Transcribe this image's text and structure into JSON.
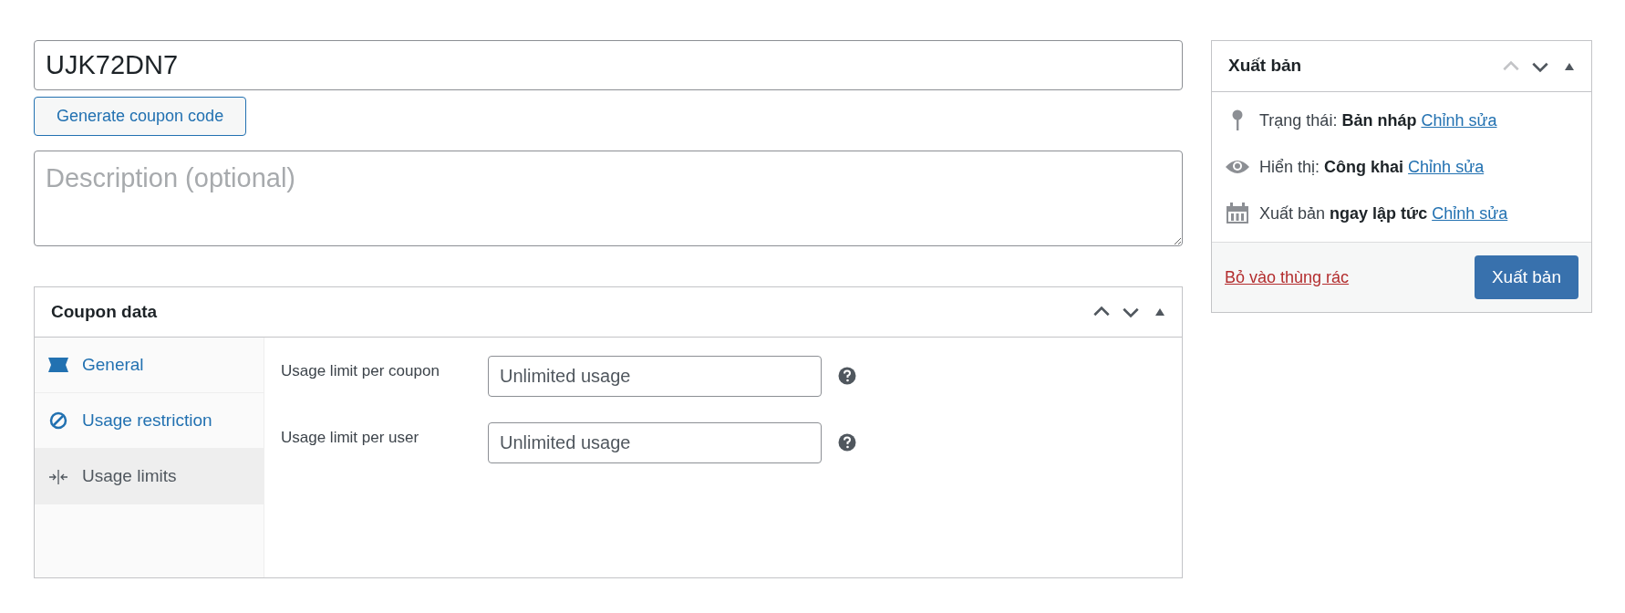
{
  "title_field": {
    "value": "UJK72DN7"
  },
  "generate_button": "Generate coupon code",
  "description_field": {
    "placeholder": "Description (optional)"
  },
  "coupon_data": {
    "title": "Coupon data",
    "controls": [
      {
        "kind": "up",
        "disabled": false
      },
      {
        "kind": "down",
        "disabled": false
      },
      {
        "kind": "toggle",
        "disabled": false
      }
    ],
    "tabs": [
      {
        "label": "General",
        "kind": "ticket",
        "selected": false
      },
      {
        "label": "Usage restriction",
        "kind": "blocked",
        "selected": false
      },
      {
        "label": "Usage limits",
        "kind": "limits",
        "selected": true
      }
    ],
    "fields": [
      {
        "label": "Usage limit per coupon",
        "placeholder": "Unlimited usage"
      },
      {
        "label": "Usage limit per user",
        "placeholder": "Unlimited usage"
      }
    ]
  },
  "publish": {
    "title": "Xuất bản",
    "controls": [
      {
        "kind": "up",
        "disabled": true
      },
      {
        "kind": "down",
        "disabled": false
      },
      {
        "kind": "toggle",
        "disabled": false
      }
    ],
    "rows": [
      {
        "kind": "pin",
        "label": "Trạng thái:",
        "value": "Bản nháp",
        "link": "Chỉnh sửa"
      },
      {
        "kind": "eye",
        "label": "Hiển thị:",
        "value": "Công khai",
        "link": "Chỉnh sửa"
      },
      {
        "kind": "calendar",
        "label": "Xuất bản",
        "value": "ngay lập tức",
        "link": "Chỉnh sửa"
      }
    ],
    "trash_link": "Bỏ vào thùng rác",
    "publish_button": "Xuất bản"
  }
}
